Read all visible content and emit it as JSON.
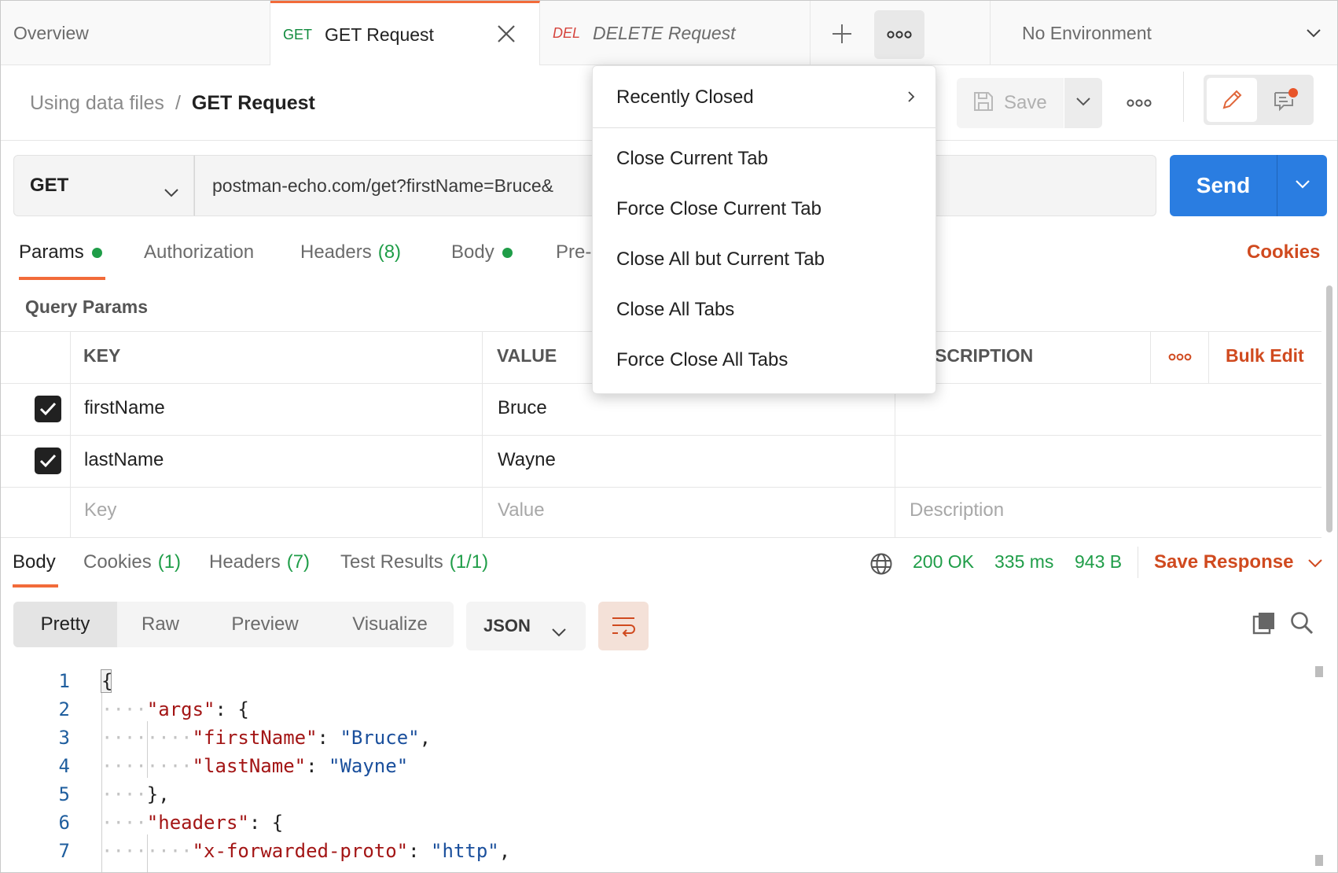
{
  "tabs": {
    "overview": "Overview",
    "get_method": "GET",
    "get_label": "GET Request",
    "del_method": "DEL",
    "del_label": "DELETE Request",
    "environment": "No Environment"
  },
  "breadcrumb": {
    "parent": "Using data files",
    "separator": "/",
    "current": "GET Request"
  },
  "toolbar": {
    "save_label": "Save"
  },
  "request": {
    "method": "GET",
    "url": "postman-echo.com/get?firstName=Bruce&",
    "send_label": "Send"
  },
  "subtabs": {
    "params": "Params",
    "authorization": "Authorization",
    "headers": "Headers",
    "headers_count": "(8)",
    "body": "Body",
    "pre": "Pre-",
    "cookies": "Cookies"
  },
  "query_params": {
    "title": "Query Params",
    "columns": {
      "key": "KEY",
      "value": "VALUE",
      "description": "SCRIPTION"
    },
    "bulk_edit": "Bulk Edit",
    "rows": [
      {
        "key": "firstName",
        "value": "Bruce",
        "description": ""
      },
      {
        "key": "lastName",
        "value": "Wayne",
        "description": ""
      }
    ],
    "placeholders": {
      "key": "Key",
      "value": "Value",
      "description": "Description"
    }
  },
  "response": {
    "tabs": {
      "body": "Body",
      "cookies": "Cookies",
      "cookies_count": "(1)",
      "headers": "Headers",
      "headers_count": "(7)",
      "tests": "Test Results",
      "tests_count": "(1/1)"
    },
    "status": "200 OK",
    "time": "335 ms",
    "size": "943 B",
    "save_response": "Save Response",
    "views": {
      "pretty": "Pretty",
      "raw": "Raw",
      "preview": "Preview",
      "visualize": "Visualize"
    },
    "format": "JSON"
  },
  "code": {
    "line_numbers": [
      "1",
      "2",
      "3",
      "4",
      "5",
      "6",
      "7"
    ],
    "l1": "{",
    "l2_key": "\"args\"",
    "l2_rest": ": {",
    "l3_key": "\"firstName\"",
    "l3_colon": ": ",
    "l3_val": "\"Bruce\"",
    "l3_end": ",",
    "l4_key": "\"lastName\"",
    "l4_colon": ": ",
    "l4_val": "\"Wayne\"",
    "l5": "},",
    "l6_key": "\"headers\"",
    "l6_rest": ": {",
    "l7_key": "\"x-forwarded-proto\"",
    "l7_colon": ": ",
    "l7_val": "\"http\"",
    "l7_end": ","
  },
  "menu": {
    "recently_closed": "Recently Closed",
    "close_current": "Close Current Tab",
    "force_close_current": "Force Close Current Tab",
    "close_all_but_current": "Close All but Current Tab",
    "close_all": "Close All Tabs",
    "force_close_all": "Force Close All Tabs"
  },
  "colors": {
    "accent_orange": "#f26b3a",
    "send_blue": "#2a7de1",
    "status_green": "#1f9d48",
    "link_orange": "#d04a1f"
  }
}
